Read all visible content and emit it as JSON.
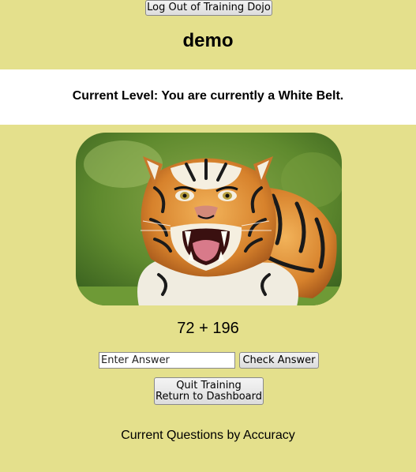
{
  "header": {
    "logout_label": "Log Out of Training Dojo",
    "username": "demo"
  },
  "level": {
    "text": "Current Level: You are currently a White Belt."
  },
  "image": {
    "subject": "tiger"
  },
  "question": {
    "text": "72 + 196"
  },
  "answer": {
    "placeholder": "Enter Answer",
    "check_label": "Check Answer"
  },
  "quit": {
    "line1": "Quit Training",
    "line2": "Return to Dashboard"
  },
  "accuracy": {
    "title": "Current Questions by Accuracy"
  },
  "colors": {
    "background": "#e4e08c",
    "band": "#ffffff"
  }
}
